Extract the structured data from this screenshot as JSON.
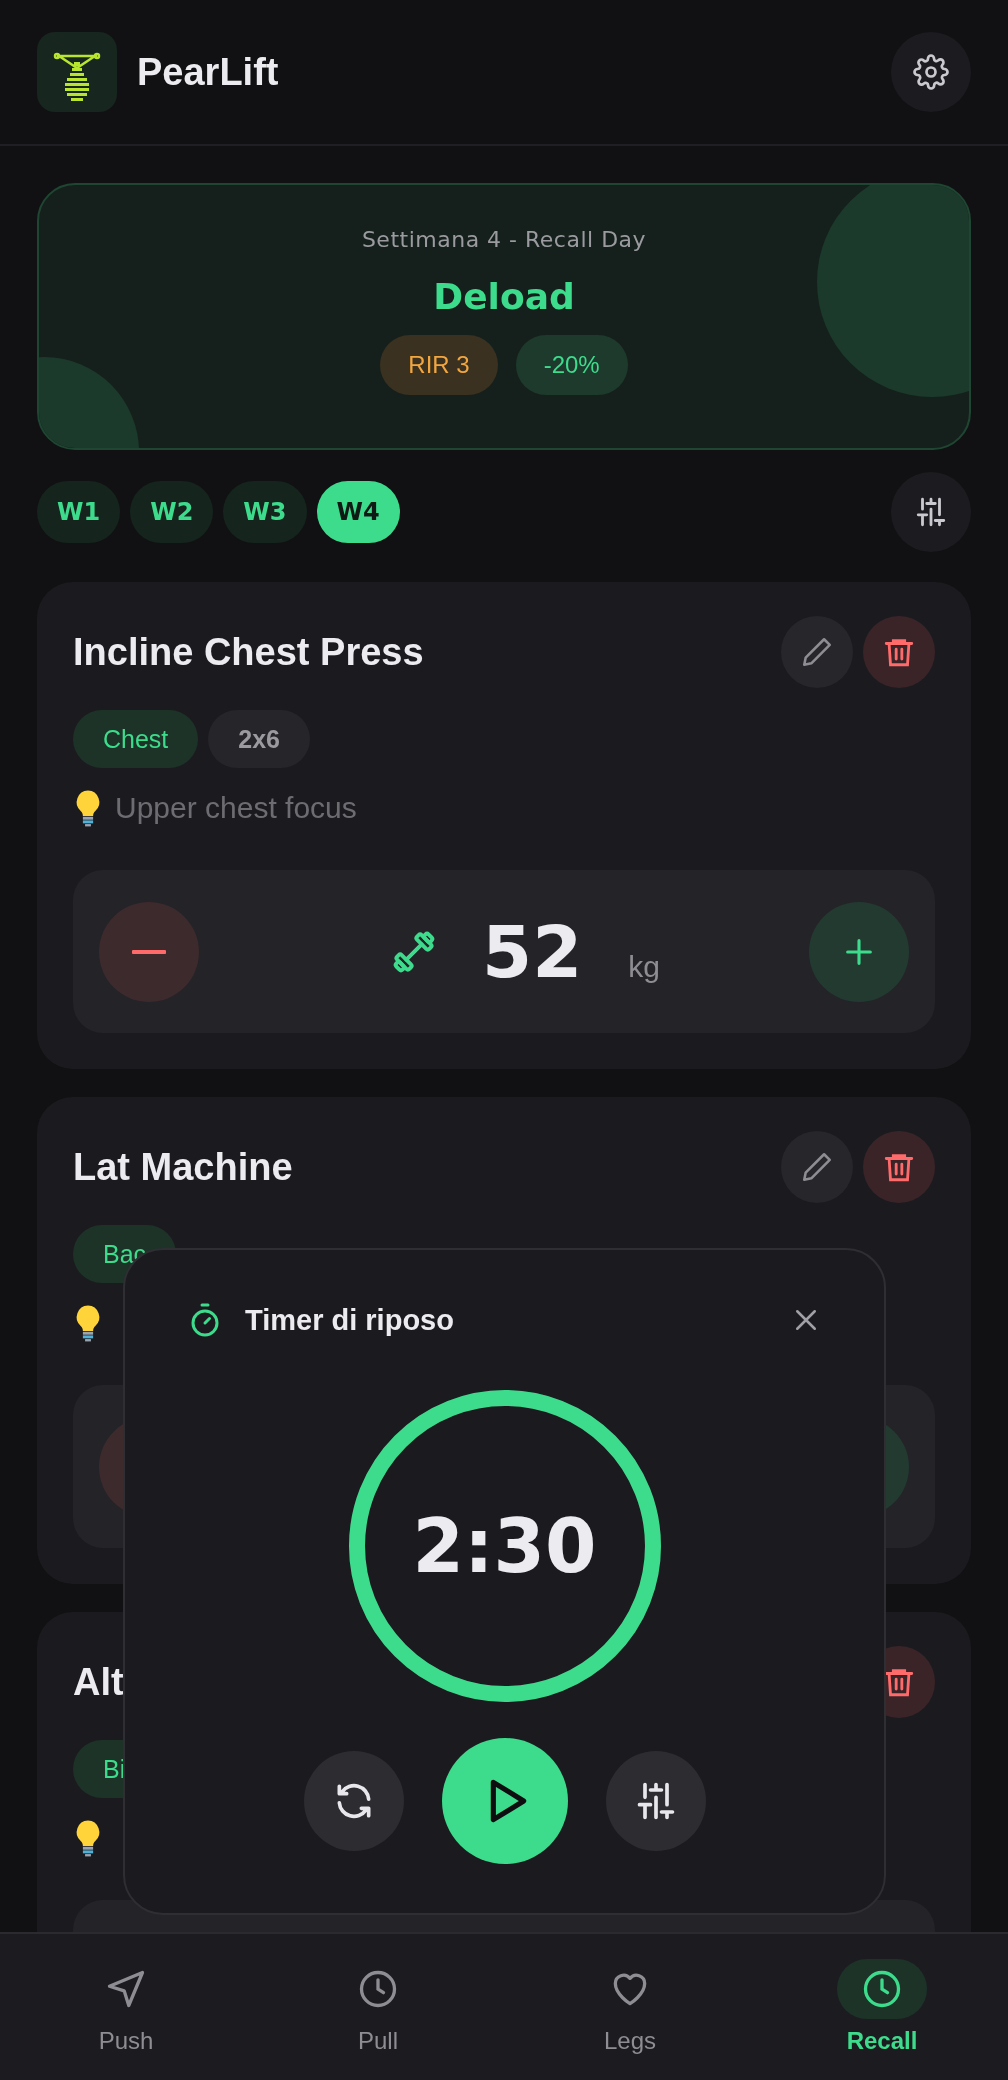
{
  "app": {
    "title": "PearLift"
  },
  "banner": {
    "subtitle": "Settimana 4 - Recall Day",
    "title": "Deload",
    "badges": [
      {
        "label": "RIR 3",
        "kind": "rir"
      },
      {
        "label": "-20%",
        "kind": "load"
      }
    ]
  },
  "weeks": [
    {
      "label": "W1",
      "selected": false
    },
    {
      "label": "W2",
      "selected": false
    },
    {
      "label": "W3",
      "selected": false
    },
    {
      "label": "W4",
      "selected": true
    }
  ],
  "exercises": [
    {
      "name": "Incline Chest Press",
      "tags": [
        {
          "label": "Chest",
          "kind": "muscle"
        },
        {
          "label": "2x6",
          "kind": "scheme"
        }
      ],
      "hint": "Upper chest focus",
      "weight": "52",
      "unit": "kg"
    },
    {
      "name": "Lat Machine",
      "tags": [
        {
          "label": "Bac",
          "kind": "muscle"
        }
      ]
    },
    {
      "name": "Alt",
      "tags": [
        {
          "label": "Bi",
          "kind": "muscle"
        }
      ]
    }
  ],
  "timer": {
    "title": "Timer di riposo",
    "time": "2:30",
    "level": 1
  },
  "nav": [
    {
      "label": "Push",
      "kind": "send",
      "selected": false
    },
    {
      "label": "Pull",
      "kind": "clock",
      "selected": false
    },
    {
      "label": "Legs",
      "kind": "heart",
      "selected": false
    },
    {
      "label": "Recall",
      "kind": "clock",
      "selected": true
    }
  ]
}
